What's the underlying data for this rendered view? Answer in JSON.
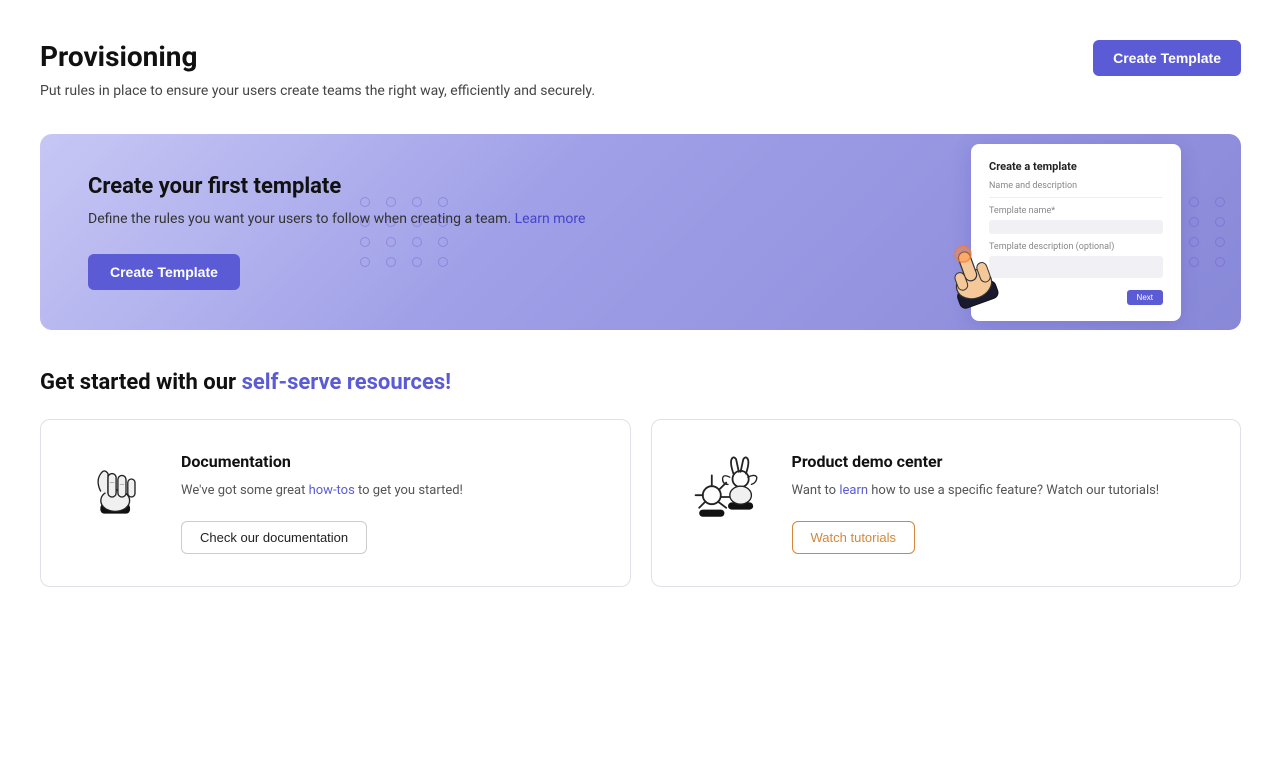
{
  "header": {
    "title": "Provisioning",
    "subtitle": "Put rules in place to ensure your users create teams the right way, efficiently and securely.",
    "create_button_label": "Create Template"
  },
  "banner": {
    "title": "Create your first template",
    "description_prefix": "Define the rules you want your users to follow when creating a team. ",
    "learn_more_label": "Learn more",
    "button_label": "Create Template",
    "mock_card": {
      "title": "Create a template",
      "section": "Name and description",
      "label1": "Template name*",
      "label2": "Template description (optional)",
      "next_btn": "Next"
    }
  },
  "resources": {
    "heading_prefix": "Get started with our ",
    "heading_highlight": "self-serve resources!",
    "cards": [
      {
        "id": "documentation",
        "title": "Documentation",
        "description_prefix": "We've got some great how-tos to get you started!",
        "description_link": "",
        "button_label": "Check our documentation",
        "button_type": "default"
      },
      {
        "id": "demo-center",
        "title": "Product demo center",
        "description_prefix": "Want to learn how to use a specific feature? Watch our tutorials!",
        "description_link": "",
        "button_label": "Watch tutorials",
        "button_type": "orange"
      }
    ]
  }
}
